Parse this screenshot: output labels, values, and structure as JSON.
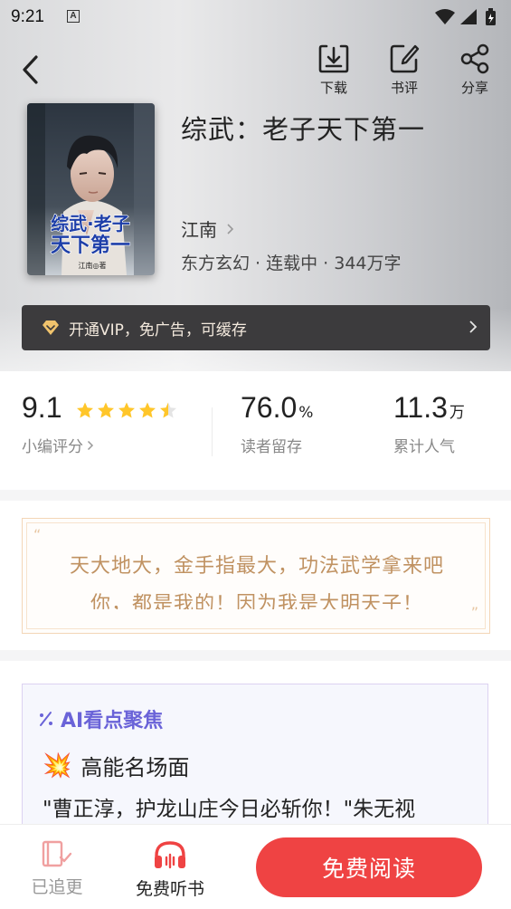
{
  "status_bar": {
    "time": "9:21",
    "notification_letter": "A"
  },
  "header": {
    "actions": [
      {
        "label": "下载",
        "icon": "download-icon"
      },
      {
        "label": "书评",
        "icon": "edit-icon"
      },
      {
        "label": "分享",
        "icon": "share-icon"
      }
    ]
  },
  "book": {
    "title": "综武：老子天下第一",
    "cover_title_line1": "综武·老子",
    "cover_title_line2": "天下第一",
    "cover_author_tag": "江南◎著",
    "author": "江南",
    "meta": "东方玄幻 · 连载中 · 344万字"
  },
  "vip_banner": {
    "text": "开通VIP，免广告，可缓存",
    "accent": "#f0c36d"
  },
  "stats": {
    "rating": {
      "value": "9.1",
      "label": "小编评分",
      "stars": 4.5
    },
    "retention": {
      "value": "76.0",
      "unit": "%",
      "label": "读者留存"
    },
    "popularity": {
      "value": "11.3",
      "unit": "万",
      "label": "累计人气"
    }
  },
  "quote": {
    "line1": "天大地大，金手指最大，功法武学拿来吧",
    "line2": "你，都是我的！因为我是大明天子！"
  },
  "ai_focus": {
    "title": "AI看点聚焦",
    "section_emoji": "💥",
    "section_title": "高能名场面",
    "text": "\"曹正淳，护龙山庄今日必斩你！\"朱无视"
  },
  "bottom_bar": {
    "followed_label": "已追更",
    "listen_label": "免费听书",
    "read_label": "免费阅读",
    "accent": "#ef4343"
  }
}
